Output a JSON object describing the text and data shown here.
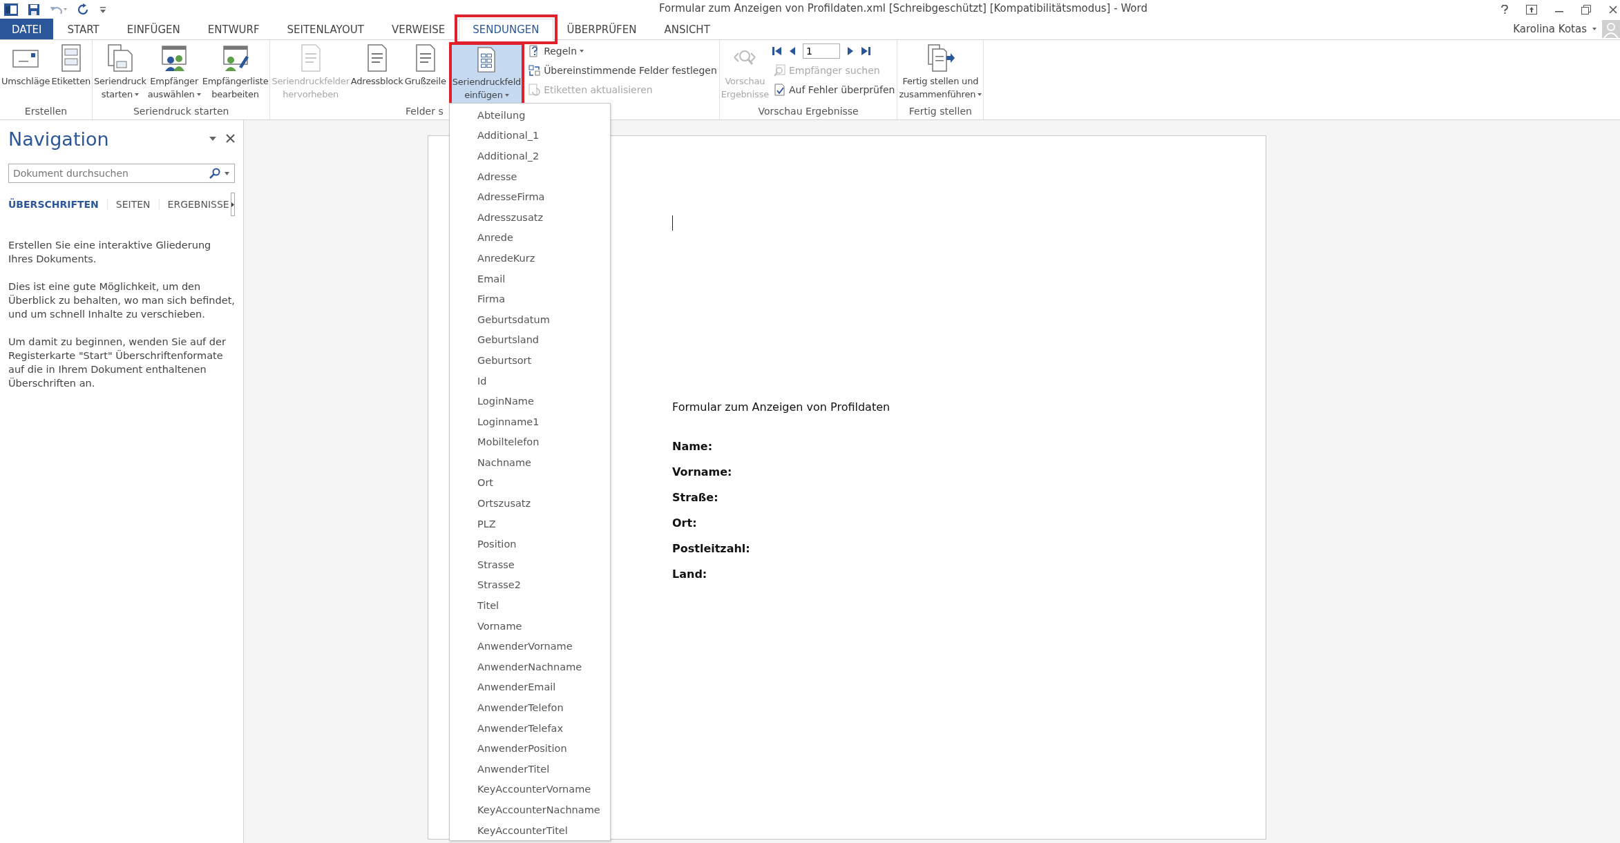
{
  "window": {
    "title": "Formular zum Anzeigen von Profildaten.xml [Schreibgeschützt] [Kompatibilitätsmodus] - Word",
    "user": "Karolina Kotas"
  },
  "tabs": [
    {
      "label": "DATEI",
      "kind": "file",
      "selected": false,
      "highlighted": false
    },
    {
      "label": "START",
      "kind": "tab",
      "selected": false,
      "highlighted": false
    },
    {
      "label": "EINFÜGEN",
      "kind": "tab",
      "selected": false,
      "highlighted": false
    },
    {
      "label": "ENTWURF",
      "kind": "tab",
      "selected": false,
      "highlighted": false
    },
    {
      "label": "SEITENLAYOUT",
      "kind": "tab",
      "selected": false,
      "highlighted": false
    },
    {
      "label": "VERWEISE",
      "kind": "tab",
      "selected": false,
      "highlighted": false
    },
    {
      "label": "SENDUNGEN",
      "kind": "tab",
      "selected": true,
      "highlighted": true
    },
    {
      "label": "ÜBERPRÜFEN",
      "kind": "tab",
      "selected": false,
      "highlighted": false
    },
    {
      "label": "ANSICHT",
      "kind": "tab",
      "selected": false,
      "highlighted": false
    }
  ],
  "ribbon": {
    "groups": [
      {
        "label": "Erstellen",
        "items": [
          {
            "kind": "large",
            "lines": [
              "Umschläge"
            ],
            "disabled": false,
            "dropdown": false,
            "highlighted": false
          },
          {
            "kind": "large",
            "lines": [
              "Etiketten"
            ],
            "disabled": false,
            "dropdown": false,
            "highlighted": false
          }
        ]
      },
      {
        "label": "Seriendruck starten",
        "items": [
          {
            "kind": "large",
            "lines": [
              "Seriendruck",
              "starten"
            ],
            "disabled": false,
            "dropdown": true,
            "highlighted": false
          },
          {
            "kind": "large",
            "lines": [
              "Empfänger",
              "auswählen"
            ],
            "disabled": false,
            "dropdown": true,
            "highlighted": false
          },
          {
            "kind": "large",
            "lines": [
              "Empfängerliste",
              "bearbeiten"
            ],
            "disabled": false,
            "dropdown": false,
            "highlighted": false
          }
        ]
      },
      {
        "label": "Felder s",
        "items": [
          {
            "kind": "large",
            "lines": [
              "Seriendruckfelder",
              "hervorheben"
            ],
            "disabled": true,
            "dropdown": false,
            "highlighted": false
          },
          {
            "kind": "large",
            "lines": [
              "Adressblock"
            ],
            "disabled": false,
            "dropdown": false,
            "highlighted": false
          },
          {
            "kind": "large",
            "lines": [
              "Grußzeile"
            ],
            "disabled": false,
            "dropdown": false,
            "highlighted": false
          },
          {
            "kind": "large",
            "lines": [
              "Seriendruckfeld",
              "einfügen"
            ],
            "disabled": false,
            "dropdown": true,
            "highlighted": true,
            "expanded": true
          },
          {
            "kind": "stack",
            "items": [
              {
                "kind": "small",
                "label": "Regeln",
                "disabled": false,
                "dropdown": true
              },
              {
                "kind": "small",
                "label": "Übereinstimmende Felder festlegen",
                "disabled": false,
                "dropdown": false
              },
              {
                "kind": "small",
                "label": "Etiketten aktualisieren",
                "disabled": true,
                "dropdown": false
              }
            ]
          }
        ]
      },
      {
        "label": "Vorschau Ergebnisse",
        "items": [
          {
            "kind": "large",
            "lines": [
              "Vorschau",
              "Ergebnisse"
            ],
            "disabled": true,
            "dropdown": false,
            "highlighted": false
          },
          {
            "kind": "stack",
            "items": [
              {
                "kind": "record_nav",
                "record": "1"
              },
              {
                "kind": "small",
                "label": "Empfänger suchen",
                "disabled": true,
                "dropdown": false
              },
              {
                "kind": "small",
                "label": "Auf Fehler überprüfen",
                "disabled": false,
                "dropdown": false
              }
            ]
          }
        ]
      },
      {
        "label": "Fertig stellen",
        "items": [
          {
            "kind": "large",
            "lines": [
              "Fertig stellen und",
              "zusammenführen"
            ],
            "disabled": false,
            "dropdown": true,
            "highlighted": false
          }
        ]
      }
    ]
  },
  "navigation": {
    "title": "Navigation",
    "search": {
      "placeholder": "Dokument durchsuchen"
    },
    "tabs": [
      {
        "label": "ÜBERSCHRIFTEN",
        "selected": true
      },
      {
        "label": "SEITEN",
        "selected": false
      },
      {
        "label": "ERGEBNISSE",
        "selected": false
      }
    ],
    "paragraphs": [
      "Erstellen Sie eine interaktive Gliederung Ihres Dokuments.",
      "Dies ist eine gute Möglichkeit, um den Überblick zu behalten, wo man sich befindet, und um schnell Inhalte zu verschieben.",
      "Um damit zu beginnen, wenden Sie auf der Registerkarte \"Start\" Überschriftenformate auf die in Ihrem Dokument enthaltenen Überschriften an."
    ]
  },
  "document": {
    "heading": "Formular zum Anzeigen von Profildaten",
    "fields": [
      "Name:",
      "Vorname:",
      "Straße:",
      "Ort:",
      "Postleitzahl:",
      "Land:"
    ]
  },
  "field_menu": {
    "items": [
      "Abteilung",
      "Additional_1",
      "Additional_2",
      "Adresse",
      "AdresseFirma",
      "Adresszusatz",
      "Anrede",
      "AnredeKurz",
      "Email",
      "Firma",
      "Geburtsdatum",
      "Geburtsland",
      "Geburtsort",
      "Id",
      "LoginName",
      "Loginname1",
      "Mobiltelefon",
      "Nachname",
      "Ort",
      "Ortszusatz",
      "PLZ",
      "Position",
      "Strasse",
      "Strasse2",
      "Titel",
      "Vorname",
      "AnwenderVorname",
      "AnwenderNachname",
      "AnwenderEmail",
      "AnwenderTelefon",
      "AnwenderTelefax",
      "AnwenderPosition",
      "AnwenderTitel",
      "KeyAccounterVorname",
      "KeyAccounterNachname",
      "KeyAccounterTitel"
    ]
  }
}
